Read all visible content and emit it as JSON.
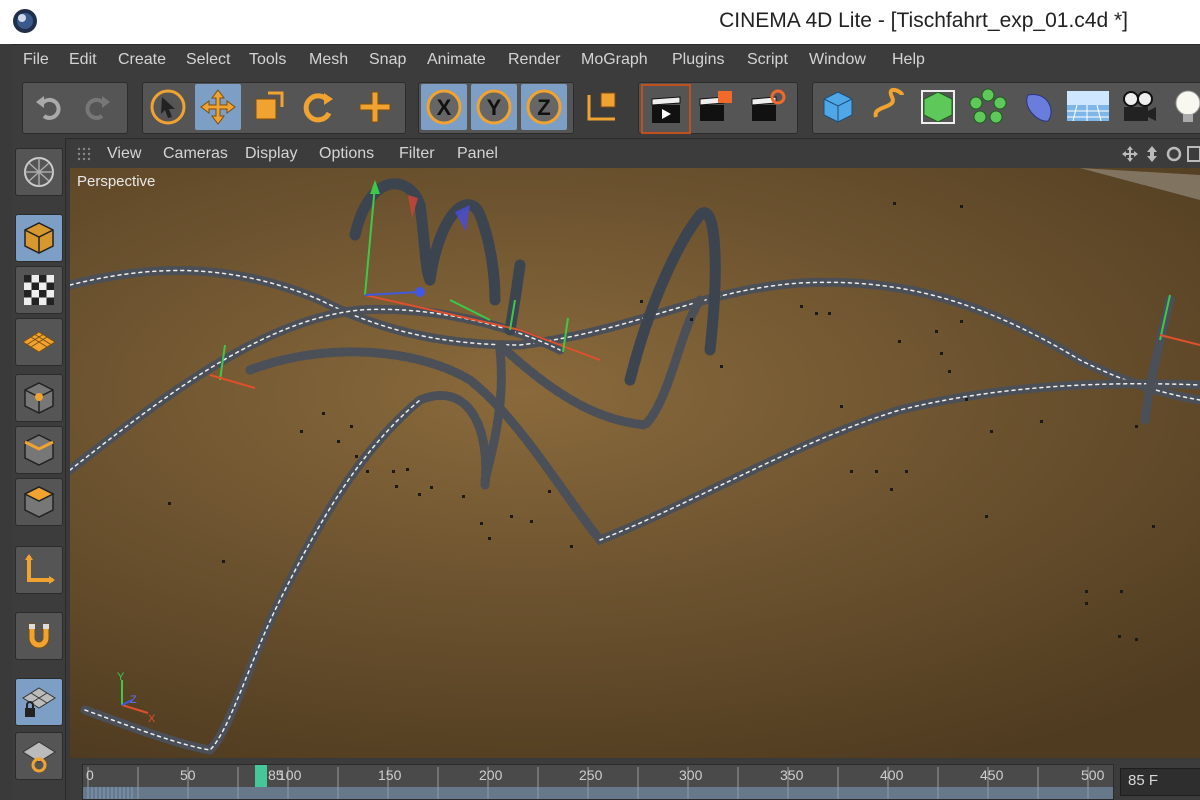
{
  "window": {
    "title": "CINEMA 4D Lite - [Tischfahrt_exp_01.c4d *]"
  },
  "menubar": {
    "items": [
      "File",
      "Edit",
      "Create",
      "Select",
      "Tools",
      "Mesh",
      "Snap",
      "Animate",
      "Render",
      "MoGraph",
      "Plugins",
      "Script",
      "Window",
      "Help"
    ]
  },
  "toolbar": {
    "axis_x": "X",
    "axis_y": "Y",
    "axis_z": "Z",
    "icons": [
      "undo-icon",
      "redo-icon",
      "live-selection-icon",
      "move-icon",
      "scale-icon",
      "rotate-icon",
      "create-tool-icon",
      "x-axis-icon",
      "y-axis-icon",
      "z-axis-icon",
      "coordinate-system-icon",
      "render-view-icon",
      "render-picture-viewer-icon",
      "render-settings-icon",
      "cube-icon",
      "spline-pen-icon",
      "subdivision-icon",
      "array-icon",
      "deformer-icon",
      "floor-icon",
      "camera-icon",
      "light-icon"
    ],
    "accent_color": "#f0a330",
    "active_color": "#7d9fc5"
  },
  "viewport_menu": {
    "items": [
      "View",
      "Cameras",
      "Display",
      "Options",
      "Filter",
      "Panel"
    ]
  },
  "viewport": {
    "label": "Perspective",
    "axis_labels": {
      "y": "Y",
      "z": "Z",
      "x": "X"
    }
  },
  "left_palette": {
    "icons": [
      "model-mode-icon",
      "object-mode-icon",
      "texture-mode-icon",
      "workplane-mode-icon",
      "points-mode-icon",
      "edges-mode-icon",
      "polygons-mode-icon",
      "axis-mode-icon",
      "snap-magnet-icon",
      "lock-workplane-icon",
      "workplane-align-icon"
    ]
  },
  "timeline": {
    "ticks": [
      "0",
      "50",
      "100",
      "150",
      "200",
      "250",
      "300",
      "350",
      "400",
      "450",
      "500"
    ],
    "current_frame_marker": "85",
    "current_frame_field": "85 F"
  }
}
